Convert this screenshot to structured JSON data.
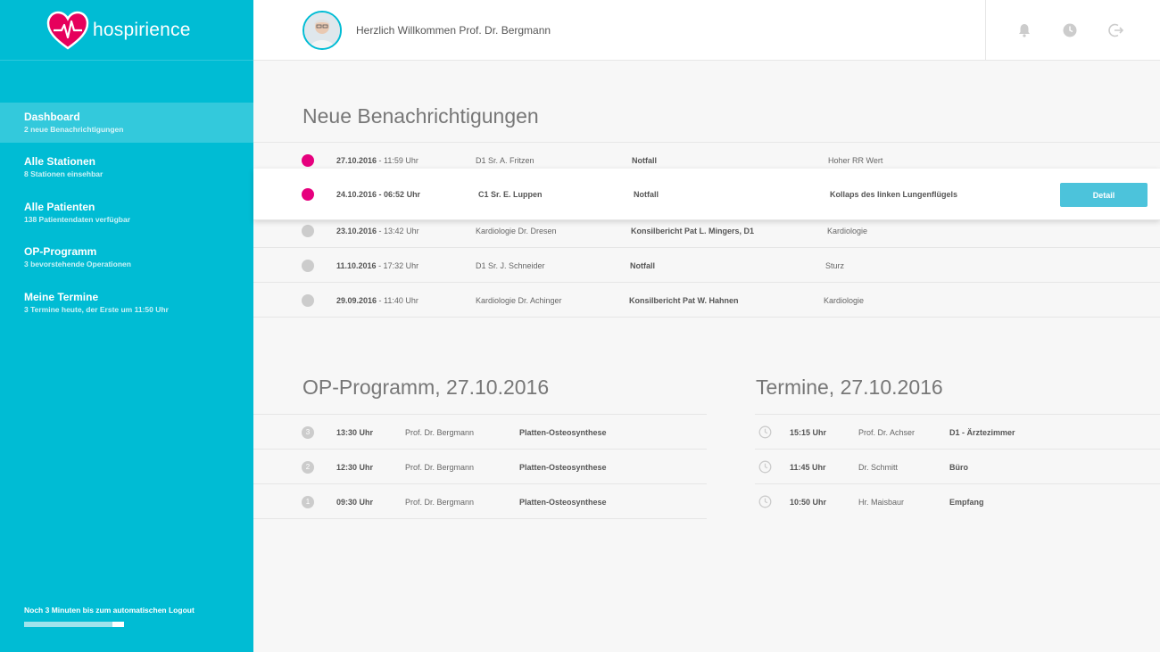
{
  "brand": {
    "name": "hospirience",
    "accent": "#00bcd4",
    "alert": "#e6007e"
  },
  "header": {
    "welcome": "Herzlich Willkommen Prof. Dr. Bergmann"
  },
  "sidebar": {
    "items": [
      {
        "title": "Dashboard",
        "sub": "2 neue Benachrichtigungen"
      },
      {
        "title": "Alle Stationen",
        "sub": "8 Stationen einsehbar"
      },
      {
        "title": "Alle Patienten",
        "sub": "138 Patientendaten verfügbar"
      },
      {
        "title": "OP-Programm",
        "sub": "3 bevorstehende Operationen"
      },
      {
        "title": "Meine Termine",
        "sub": "3 Termine heute, der Erste um 11:50 Uhr"
      }
    ],
    "logout_note": "Noch 3 Minuten bis zum automatischen Logout",
    "logout_progress": 0.88
  },
  "notifications": {
    "title": "Neue Benachrichtigungen",
    "detail_label": "Detail",
    "rows": [
      {
        "date": "27.10.2016",
        "time": " - 11:59 Uhr",
        "person": "D1 Sr. A. Fritzen",
        "type": "Notfall",
        "desc": "Hoher RR Wert"
      },
      {
        "date": "24.10.2016",
        "time": " - 06:52 Uhr",
        "person": "C1 Sr. E. Luppen",
        "type": "Notfall",
        "desc": "Kollaps des linken Lungenflügels"
      },
      {
        "date": "23.10.2016",
        "time": " - 13:42 Uhr",
        "person": "Kardiologie Dr. Dresen",
        "type": "Konsilbericht Pat L. Mingers, D1",
        "desc": "Kardiologie"
      },
      {
        "date": "11.10.2016",
        "time": " - 17:32 Uhr",
        "person": "D1 Sr. J. Schneider",
        "type": "Notfall",
        "desc": "Sturz"
      },
      {
        "date": "29.09.2016",
        "time": " - 11:40 Uhr",
        "person": "Kardiologie Dr. Achinger",
        "type": "Konsilbericht Pat W. Hahnen",
        "desc": "Kardiologie"
      }
    ]
  },
  "op": {
    "title": "OP-Programm, 27.10.2016",
    "rows": [
      {
        "num": "3",
        "time": "13:30 Uhr",
        "doctor": "Prof. Dr. Bergmann",
        "procedure": "Platten-Osteosynthese"
      },
      {
        "num": "2",
        "time": "12:30 Uhr",
        "doctor": "Prof. Dr. Bergmann",
        "procedure": "Platten-Osteosynthese"
      },
      {
        "num": "1",
        "time": "09:30 Uhr",
        "doctor": "Prof. Dr. Bergmann",
        "procedure": "Platten-Osteosynthese"
      }
    ]
  },
  "termine": {
    "title": "Termine, 27.10.2016",
    "rows": [
      {
        "time": "15:15 Uhr",
        "person": "Prof. Dr. Achser",
        "place": "D1 - Ärztezimmer"
      },
      {
        "time": "11:45 Uhr",
        "person": "Dr. Schmitt",
        "place": "Büro"
      },
      {
        "time": "10:50 Uhr",
        "person": "Hr. Maisbaur",
        "place": "Empfang"
      }
    ]
  }
}
